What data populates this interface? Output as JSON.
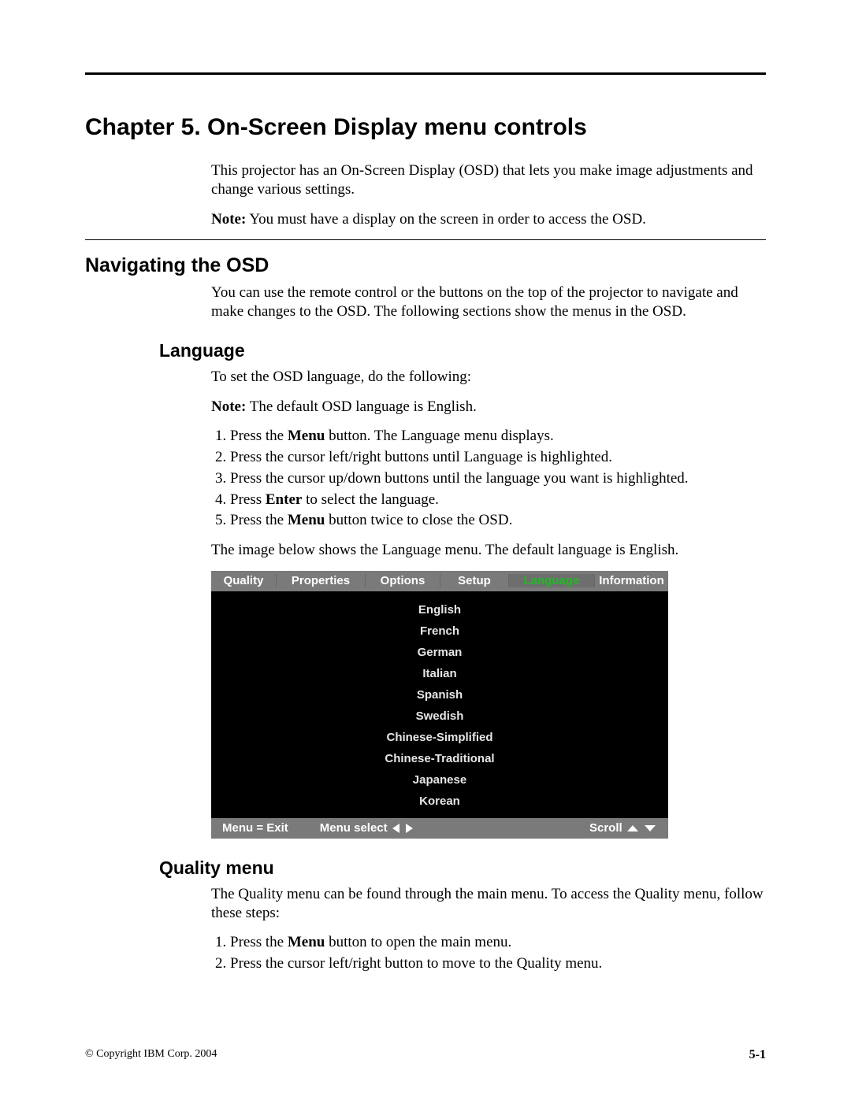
{
  "chapter_title": "Chapter 5. On-Screen Display menu controls",
  "intro": "This projector has an On-Screen Display (OSD) that lets you make image adjustments and change various settings.",
  "note_label": "Note:",
  "intro_note": " You must have a display on the screen in order to access the OSD.",
  "nav_heading": "Navigating the OSD",
  "nav_body": "You can use the remote control or the buttons on the top of the projector to navigate and make changes to the OSD. The following sections show the menus in the OSD.",
  "lang_heading": "Language",
  "lang_intro": "To set the OSD language, do the following:",
  "lang_note": " The default OSD language is English.",
  "lang_steps": {
    "s1a": "Press the ",
    "s1_bold": "Menu",
    "s1b": " button. The Language menu displays.",
    "s2": "Press the cursor left/right buttons until Language is highlighted.",
    "s3": "Press the cursor up/down buttons until the language you want is highlighted.",
    "s4a": "Press ",
    "s4_bold": "Enter",
    "s4b": " to select the language.",
    "s5a": "Press the ",
    "s5_bold": "Menu",
    "s5b": " button twice to close the OSD."
  },
  "lang_caption": "The image below shows the Language menu. The default language is English.",
  "osd": {
    "tabs": {
      "quality": "Quality",
      "properties": "Properties",
      "options": "Options",
      "setup": "Setup",
      "language": "Language",
      "information": "Information"
    },
    "languages": [
      "English",
      "French",
      "German",
      "Italian",
      "Spanish",
      "Swedish",
      "Chinese-Simplified",
      "Chinese-Traditional",
      "Japanese",
      "Korean"
    ],
    "footer": {
      "exit": "Menu = Exit",
      "select": "Menu select",
      "scroll": "Scroll"
    }
  },
  "quality_heading": "Quality menu",
  "quality_body": "The Quality menu can be found through the main menu. To access the Quality menu, follow these steps:",
  "quality_steps": {
    "s1a": "Press the ",
    "s1_bold": "Menu",
    "s1b": " button to open the main menu.",
    "s2": "Press the cursor left/right button to move to the Quality menu."
  },
  "footer_left": "© Copyright IBM Corp. 2004",
  "footer_right": "5-1"
}
